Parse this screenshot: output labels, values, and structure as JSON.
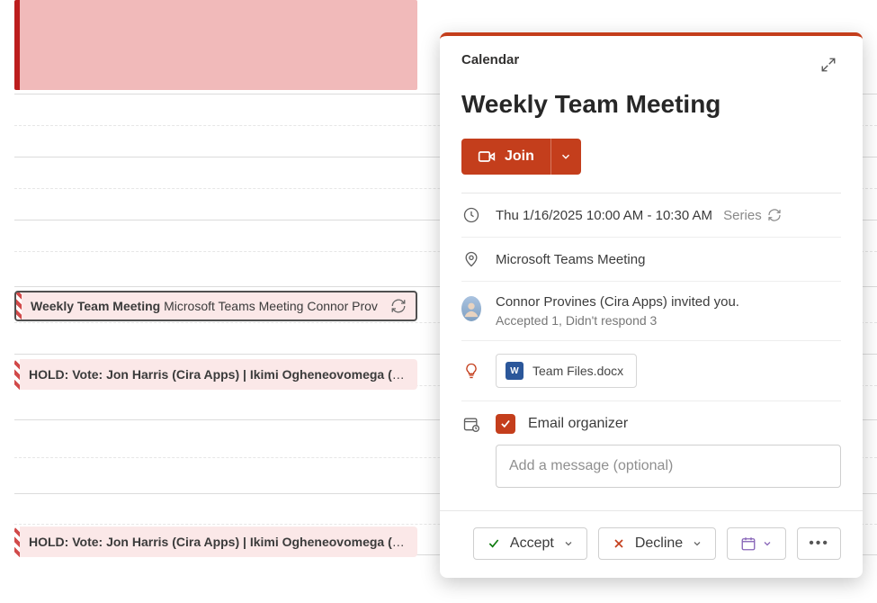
{
  "calendar": {
    "events": [
      {
        "title": "Weekly Team Meeting",
        "subtitle": "Microsoft Teams Meeting Connor Prov"
      },
      {
        "title": "HOLD: Vote: Jon Harris (Cira Apps) | Ikimi Ogheneovomega (Cira"
      },
      {
        "title": "HOLD: Vote: Jon Harris (Cira Apps) | Ikimi Ogheneovomega (Cira"
      }
    ]
  },
  "panel": {
    "label": "Calendar",
    "title": "Weekly Team Meeting",
    "join_label": "Join",
    "when": "Thu 1/16/2025 10:00 AM - 10:30 AM",
    "series_label": "Series",
    "location": "Microsoft Teams Meeting",
    "organizer_line": "Connor Provines (Cira Apps) invited you.",
    "response_summary": "Accepted 1, Didn't respond 3",
    "attachment_name": "Team Files.docx",
    "email_organizer_label": "Email organizer",
    "email_organizer_checked": true,
    "message_placeholder": "Add a message (optional)",
    "accept_label": "Accept",
    "decline_label": "Decline"
  }
}
